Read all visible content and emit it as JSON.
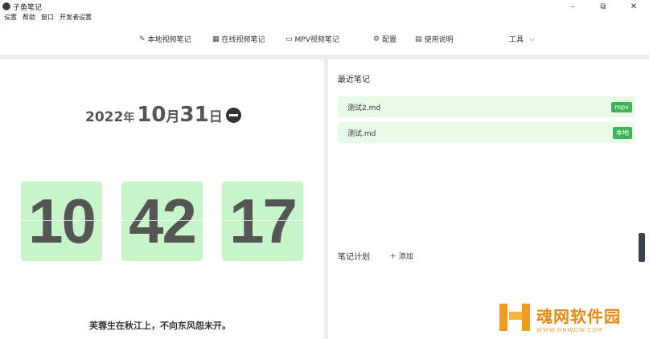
{
  "window": {
    "title": "子鱼笔记",
    "min": "–",
    "max": "⧉",
    "close": "✕"
  },
  "menu": [
    "设置",
    "帮助",
    "窗口",
    "开发者设置"
  ],
  "toolbar": {
    "local_video": "本地视频笔记",
    "online_video": "在线视频笔记",
    "mpv_video": "MPV视频笔记",
    "config": "配置",
    "manual": "使用说明",
    "tools": "工具",
    "icons": {
      "local": "✎",
      "online": "▦",
      "mpv": "▭",
      "config": "⚙",
      "manual": "▤",
      "tools_caret": "⌵"
    }
  },
  "clock": {
    "year": "2022",
    "year_unit": "年",
    "month": "10",
    "month_unit": "月",
    "day": "31",
    "day_unit": "日",
    "hours": "10",
    "minutes": "42",
    "seconds": "17",
    "flip_color": "#c5f5c9"
  },
  "poem": "芙蓉生在秋江上，不向东风怨未开。",
  "recent": {
    "title": "最近笔记",
    "items": [
      {
        "name": "测试2.md",
        "tag": "mpv"
      },
      {
        "name": "测试.md",
        "tag": "本地"
      }
    ],
    "tag_color": "#3cb55a"
  },
  "plan": {
    "title": "笔记计划",
    "add": "＋ 添加"
  },
  "watermark": {
    "main": "魂网软件园",
    "sub": "WWW.HNWDW.COM"
  }
}
